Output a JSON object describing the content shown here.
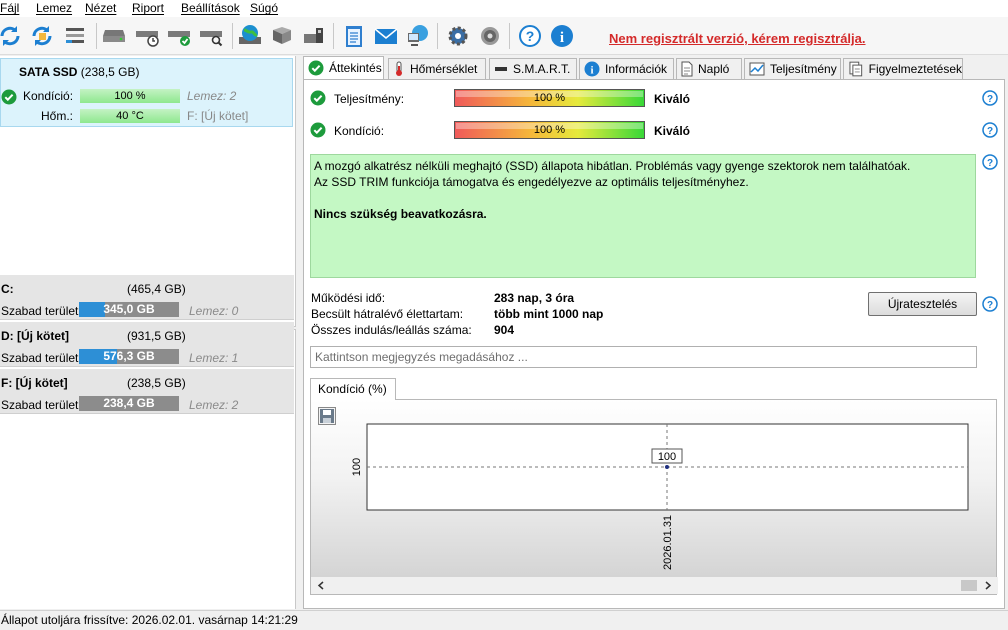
{
  "menu": [
    "Fájl",
    "Lemez",
    "Nézet",
    "Riport",
    "Beállítások",
    "Súgó"
  ],
  "register_text": "Nem regisztrált verzió, kérem regisztrálja.",
  "disk": {
    "name": "SATA SSD",
    "size": "(238,5 GB)",
    "health_label": "Kondíció:",
    "health_value": "100 %",
    "health_disk": "Lemez: 2",
    "temp_label": "Hőm.:",
    "temp_value": "40 °C",
    "temp_vol": "F: [Új kötet]"
  },
  "volumes": [
    {
      "name": "C:",
      "size": "(465,4 GB)",
      "free_label": "Szabad terület",
      "free": "345,0 GB",
      "used_fraction": 0.26,
      "disk": "Lemez: 0"
    },
    {
      "name": "D: [Új kötet]",
      "size": "(931,5 GB)",
      "free_label": "Szabad terület",
      "free": "576,3 GB",
      "used_fraction": 0.38,
      "disk": "Lemez: 1"
    },
    {
      "name": "F: [Új kötet]",
      "size": "(238,5 GB)",
      "free_label": "Szabad terület",
      "free": "238,4 GB",
      "used_fraction": 0.0,
      "disk": "Lemez: 2"
    }
  ],
  "tabs": [
    "Áttekintés",
    "Hőmérséklet",
    "S.M.A.R.T.",
    "Információk",
    "Napló",
    "Teljesítmény",
    "Figyelmeztetések"
  ],
  "overview": {
    "performance_label": "Teljesítmény:",
    "performance_value": "100 %",
    "performance_level": 1.0,
    "performance_verdict": "Kiváló",
    "health_label": "Kondíció:",
    "health_value": "100 %",
    "health_level": 1.0,
    "health_verdict": "Kiváló",
    "info_line1": "A mozgó alkatrész nélküli meghajtó (SSD) állapota hibátlan. Problémás vagy gyenge szektorok nem találhatóak.",
    "info_line2": "Az SSD TRIM funkciója támogatva és engedélyezve az optimális teljesítményhez.",
    "info_bold": "Nincs szükség beavatkozásra.",
    "uptime_label": "Működési idő:",
    "uptime_value": "283 nap, 3 óra",
    "life_label": "Becsült hátralévő élettartam:",
    "life_value": "több mint 1000 nap",
    "starts_label": "Összes indulás/leállás száma:",
    "starts_value": "904",
    "retest_label": "Újratesztelés",
    "comment_placeholder": "Kattintson megjegyzés megadásához ..."
  },
  "chart_tab_label": "Kondíció  (%)",
  "chart_data": {
    "type": "line",
    "x": [
      "2026.01.31"
    ],
    "series": [
      {
        "values": [
          100
        ]
      }
    ],
    "ytick_labels": [
      "100"
    ],
    "point_label": "100",
    "grid": false
  },
  "status": "Állapot utoljára frissítve: 2026.02.01. vasárnap 14:21:29",
  "colors": {
    "accent": "#d42a2a",
    "ok_green": "#1d9b3c",
    "info_bg": "#c4f8c4",
    "bar_blue": "#2d8fd6"
  }
}
